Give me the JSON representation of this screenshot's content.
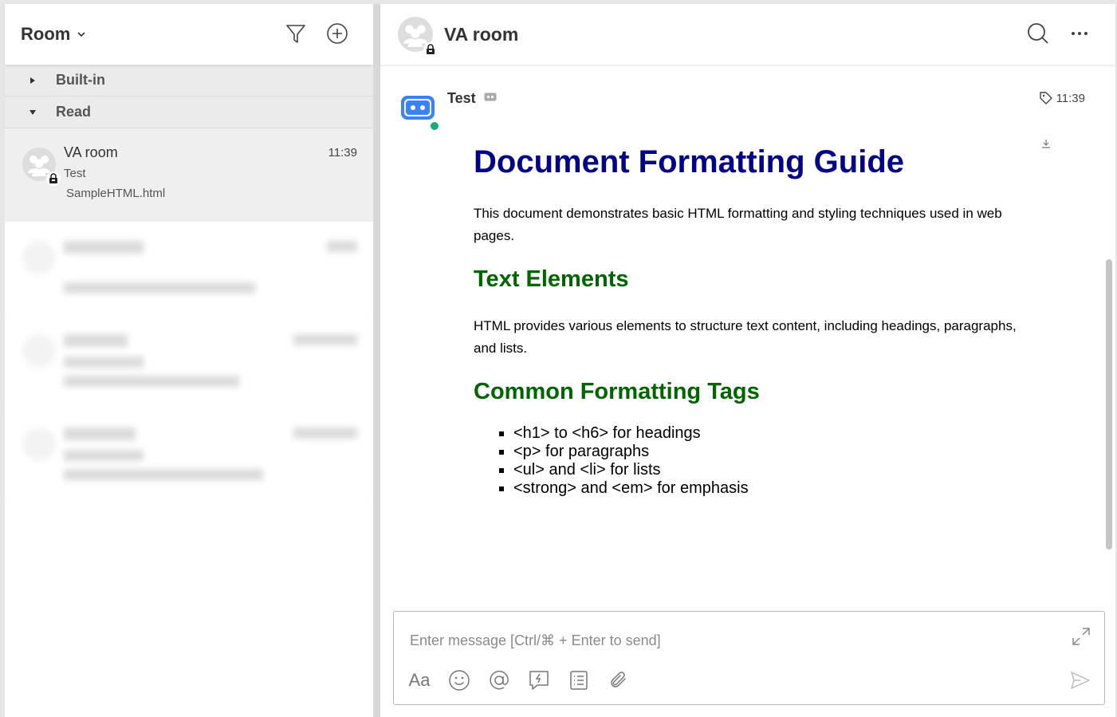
{
  "left_panel": {
    "title": "Room",
    "groups": [
      {
        "label": "Built-in",
        "expanded": false
      },
      {
        "label": "Read",
        "expanded": true
      }
    ],
    "rooms": [
      {
        "name": "VA room",
        "time": "11:39",
        "line1": "Test",
        "line2": "SampleHTML.html",
        "active": true
      }
    ]
  },
  "right_panel": {
    "title": "VA room",
    "message": {
      "sender": "Test",
      "time": "11:39"
    },
    "document": {
      "h1": "Document Formatting Guide",
      "intro": "This document demonstrates basic HTML formatting and styling techniques used in web pages.",
      "h2_text": "Text Elements",
      "text_para": "HTML provides various elements to structure text content, including headings, paragraphs, and lists.",
      "h2_tags": "Common Formatting Tags",
      "list": [
        "<h1> to <h6> for headings",
        "<p> for paragraphs",
        "<ul> and <li> for lists",
        "<strong> and <em> for emphasis"
      ]
    },
    "composer": {
      "placeholder": "Enter message [Ctrl/⌘ + Enter to send]",
      "font_tool": "Aa"
    }
  },
  "colors": {
    "h1": "#00008b",
    "h2": "#006400",
    "online": "#1aaa7a",
    "bot_blue": "#3b82f6"
  }
}
